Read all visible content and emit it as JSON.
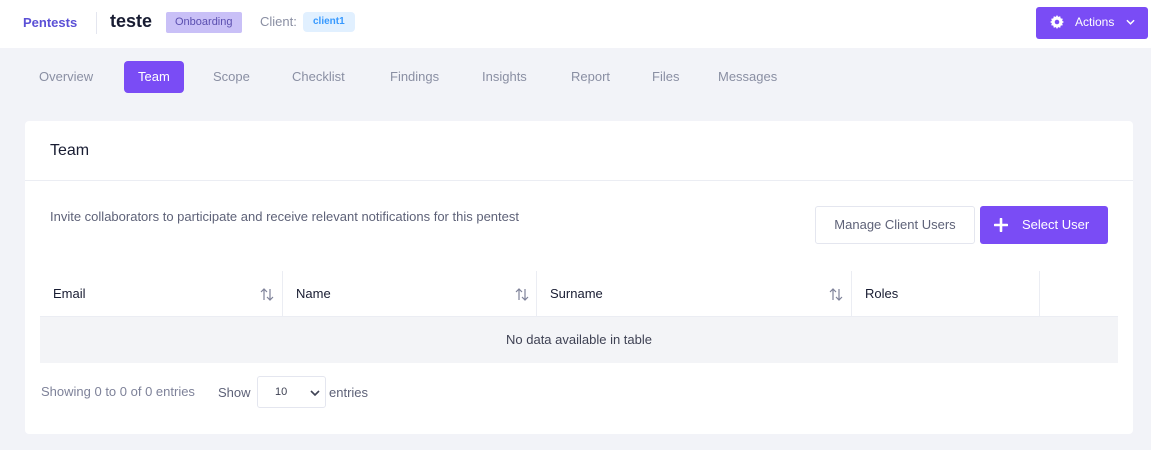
{
  "header": {
    "brand": "Pentests",
    "title": "teste",
    "status_badge": "Onboarding",
    "client_label": "Client:",
    "client_name": "client1",
    "actions_label": "Actions"
  },
  "tabs": [
    {
      "label": "Overview",
      "active": false
    },
    {
      "label": "Team",
      "active": true
    },
    {
      "label": "Scope",
      "active": false
    },
    {
      "label": "Checklist",
      "active": false
    },
    {
      "label": "Findings",
      "active": false
    },
    {
      "label": "Insights",
      "active": false
    },
    {
      "label": "Report",
      "active": false
    },
    {
      "label": "Files",
      "active": false
    },
    {
      "label": "Messages",
      "active": false
    }
  ],
  "team_card": {
    "title": "Team",
    "description": "Invite collaborators to participate and receive relevant notifications for this pentest",
    "manage_button": "Manage Client Users",
    "select_button": "Select User"
  },
  "table": {
    "columns": [
      "Email",
      "Name",
      "Surname",
      "Roles"
    ],
    "empty_message": "No data available in table",
    "info": "Showing 0 to 0 of 0 entries",
    "show_label": "Show",
    "page_length": "10",
    "entries_label": "entries"
  },
  "colors": {
    "accent": "#7a4cf5",
    "brand": "#5b50d6",
    "badge_bg": "#c9c0f7",
    "client_badge_bg": "#e1f0ff",
    "client_badge_text": "#3699ff"
  }
}
